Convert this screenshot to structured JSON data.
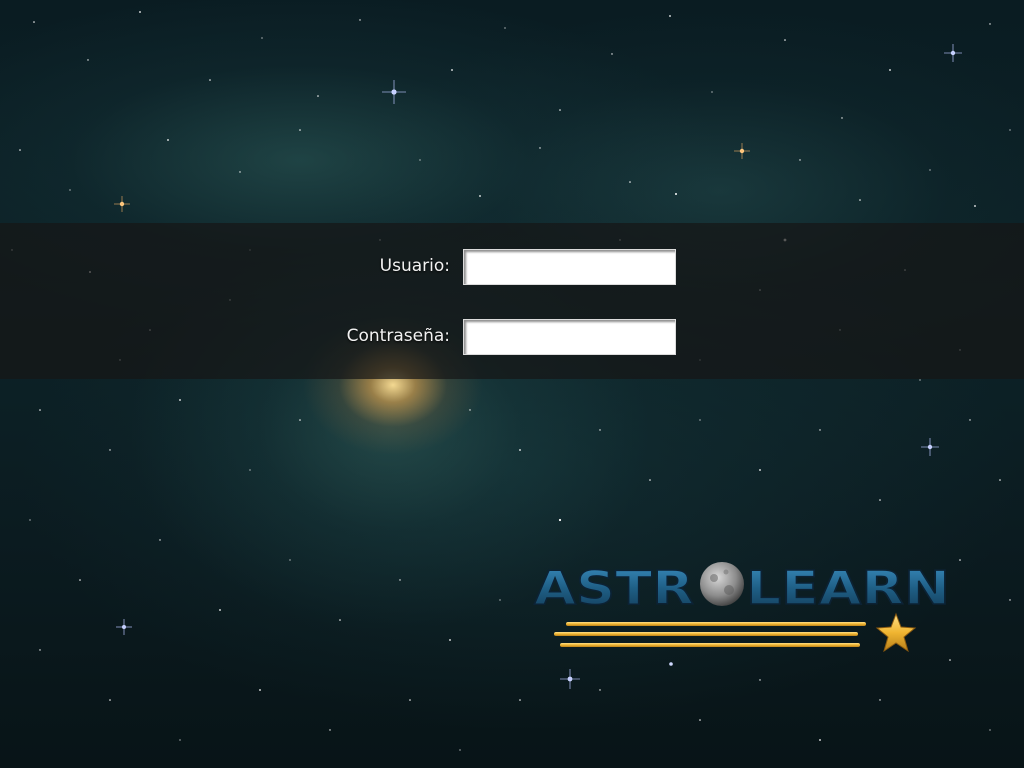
{
  "login": {
    "username_label": "Usuario:",
    "username_value": "",
    "password_label": "Contraseña:",
    "password_value": ""
  },
  "logo": {
    "text": "ASTROLEARN",
    "icon": "moon-icon",
    "accent_icon": "star-icon"
  },
  "colors": {
    "band": "#161616",
    "label": "#f2f2f2",
    "logo_blue": "#2b6f99",
    "logo_gold": "#f0b531"
  }
}
